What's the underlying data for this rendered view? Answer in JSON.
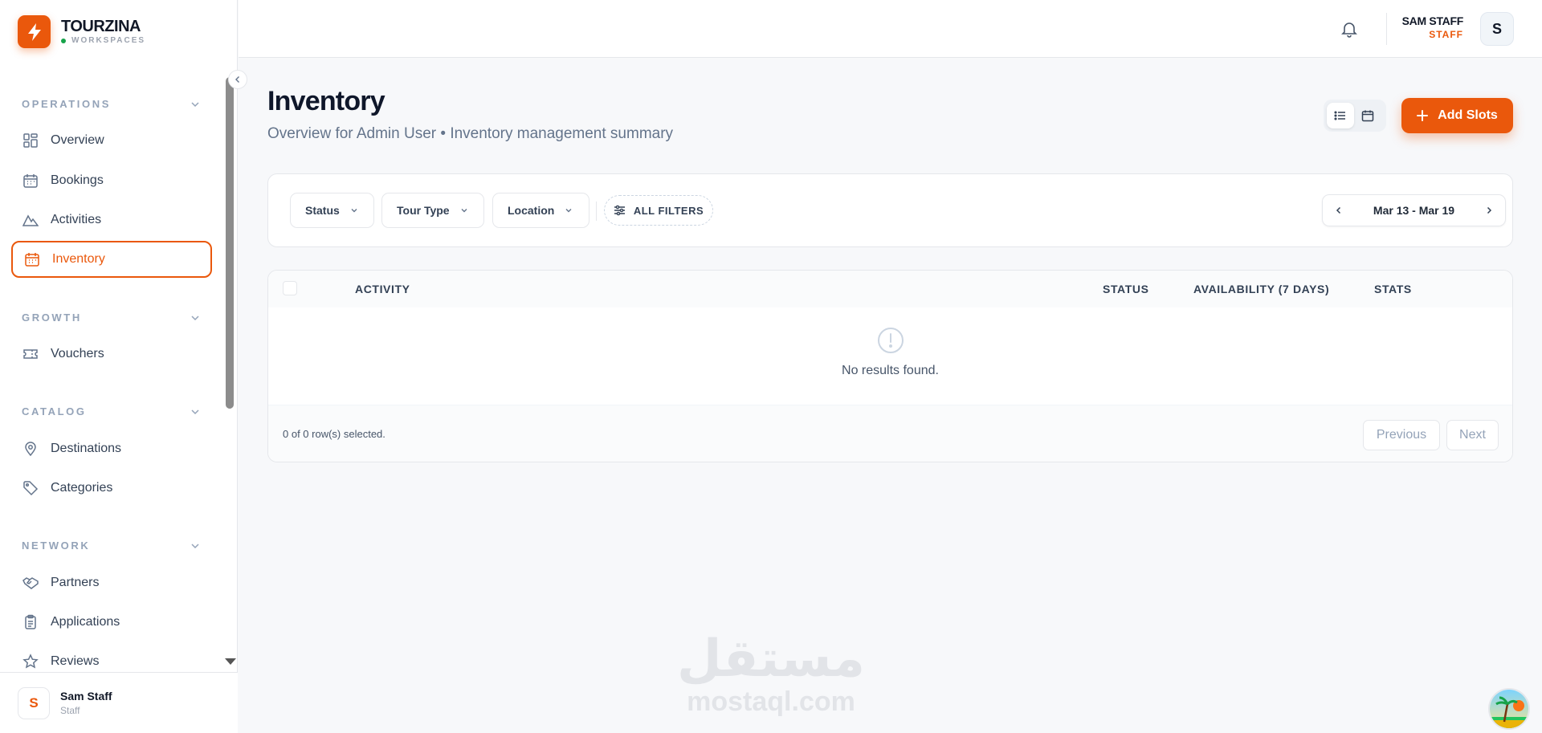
{
  "brand": {
    "name": "TOURZINA",
    "subtitle": "WORKSPACES"
  },
  "sidebar": {
    "sections": [
      {
        "title": "OPERATIONS"
      },
      {
        "title": "GROWTH"
      },
      {
        "title": "CATALOG"
      },
      {
        "title": "NETWORK"
      }
    ],
    "items": [
      {
        "label": "Overview",
        "icon": "grid-icon"
      },
      {
        "label": "Bookings",
        "icon": "calendar-icon"
      },
      {
        "label": "Activities",
        "icon": "mountain-icon"
      },
      {
        "label": "Inventory",
        "icon": "calendar-icon",
        "active": true
      },
      {
        "label": "Vouchers",
        "icon": "ticket-icon"
      },
      {
        "label": "Destinations",
        "icon": "map-pin-icon"
      },
      {
        "label": "Categories",
        "icon": "tag-icon"
      },
      {
        "label": "Partners",
        "icon": "handshake-icon"
      },
      {
        "label": "Applications",
        "icon": "clipboard-icon"
      },
      {
        "label": "Reviews",
        "icon": "star-icon"
      }
    ],
    "user": {
      "avatar": "S",
      "name": "Sam Staff",
      "role": "Staff"
    }
  },
  "topbar": {
    "user_name": "SAM STAFF",
    "user_role": "STAFF",
    "avatar": "S"
  },
  "page": {
    "title": "Inventory",
    "subtitle": "Overview for Admin User • Inventory management summary",
    "add_button": "Add Slots"
  },
  "filters": {
    "status": "Status",
    "tour_type": "Tour Type",
    "location": "Location",
    "all_filters": "ALL FILTERS",
    "date_range": "Mar 13 - Mar 19"
  },
  "table": {
    "columns": [
      "ACTIVITY",
      "STATUS",
      "AVAILABILITY (7 DAYS)",
      "STATS"
    ],
    "empty_text": "No results found.",
    "selection_text": "0 of 0 row(s) selected.",
    "previous": "Previous",
    "next": "Next"
  },
  "watermark": {
    "arabic": "مستقل",
    "latin": "mostaql.com"
  },
  "colors": {
    "accent": "#ea580c",
    "text": "#0f172a",
    "muted": "#64748b"
  }
}
